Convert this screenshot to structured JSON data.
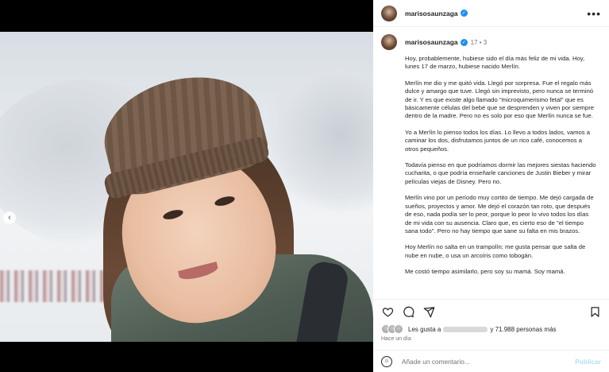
{
  "post": {
    "username": "marisosaunzaga",
    "caption_age": "17",
    "caption_meta_suffix": "3",
    "caption_paragraphs": [
      "Hoy, probablemente, hubiese sido el día más feliz de mi vida. Hoy, lunes 17 de marzo, hubiese nacido Merlín.",
      "Merlín me dio y me quitó vida. Llegó por sorpresa. Fue el regalo más dulce y amargo que tuve. Llegó sin imprevisto, pero nunca se terminó de ir. Y es que existe algo llamado \"microquimerismo fetal\" que es básicamente células del bebé que se desprenden y viven por siempre dentro de la madre. Pero no es solo por eso que Merlín nunca se fue.",
      "Yo a Merlín lo pienso todos los días. Lo llevo a todos lados, vamos a caminar los dos, disfrutamos juntos de un rico café, conocemos a otros pequeños.",
      "Todavía pienso en que podríamos dormir las mejores siestas haciendo cucharita, o que podría enseñarle canciones de Justin Bieber y mirar películas viejas de Disney. Pero no.",
      "Merlín vino por un período muy cortito de tiempo. Me dejó cargada de sueños, proyectos y amor. Me dejó el corazón tan roto, que después de eso, nada podía ser lo peor, porque lo peor lo vivo todos los días de mi vida con su ausencia. Claro que, es cierto eso de \"el tiempo sana todo\". Pero no hay tiempo que sane su falta en mis brazos.",
      "Hoy Merlín no salta en un trampolín; me gusta pensar que salta de nube en nube, o usa un arcoíris como tobogán.",
      "Me costó tiempo asimilarlo, pero soy su mamá. Soy mamá."
    ],
    "likes_prefix": "Les gusta a",
    "likes_suffix": "y 71.988 personas más",
    "time_ago": "Hace un día",
    "carousel_count": 5,
    "carousel_active_index": 4
  },
  "icons": {
    "more": "more-options-icon",
    "like": "heart-icon",
    "comment": "comment-icon",
    "share": "share-icon",
    "save": "bookmark-icon",
    "emoji": "emoji-icon",
    "prev": "chevron-left-icon",
    "verified": "verified-badge-icon"
  },
  "comment_box": {
    "placeholder": "Añade un comentario...",
    "publish_label": "Publicar"
  },
  "colors": {
    "verified": "#1f8ff0",
    "publish_disabled": "#b2dffc"
  }
}
